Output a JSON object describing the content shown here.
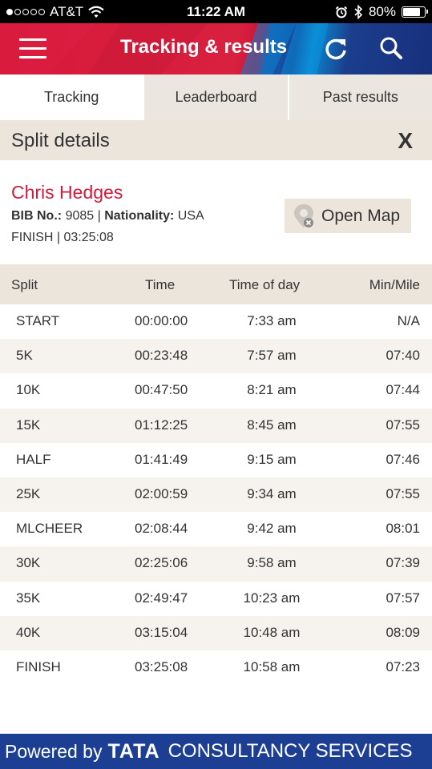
{
  "status_bar": {
    "carrier": "AT&T",
    "time": "11:22 AM",
    "battery": "80%",
    "battery_level": 0.8,
    "icons": [
      "wifi-icon",
      "alarm-icon",
      "bluetooth-icon",
      "battery-icon"
    ]
  },
  "header": {
    "title": "Tracking & results",
    "icons": [
      "menu-icon",
      "refresh-icon",
      "search-icon"
    ]
  },
  "tabs": [
    {
      "label": "Tracking",
      "active": true
    },
    {
      "label": "Leaderboard",
      "active": false
    },
    {
      "label": "Past results",
      "active": false
    }
  ],
  "split_details": {
    "title": "Split details",
    "close_label": "X"
  },
  "runner": {
    "name": "Chris Hedges",
    "bib_label": "BIB No.:",
    "bib": "9085",
    "nationality_label": "Nationality:",
    "nationality": "USA",
    "finish": "FINISH | 03:25:08",
    "open_map_label": "Open Map"
  },
  "table": {
    "columns": [
      "Split",
      "Time",
      "Time of day",
      "Min/Mile"
    ],
    "rows": [
      {
        "split": "START",
        "time": "00:00:00",
        "time_of_day": "7:33 am",
        "min_mile": "N/A"
      },
      {
        "split": "5K",
        "time": "00:23:48",
        "time_of_day": "7:57 am",
        "min_mile": "07:40"
      },
      {
        "split": "10K",
        "time": "00:47:50",
        "time_of_day": "8:21 am",
        "min_mile": "07:44"
      },
      {
        "split": "15K",
        "time": "01:12:25",
        "time_of_day": "8:45 am",
        "min_mile": "07:55"
      },
      {
        "split": "HALF",
        "time": "01:41:49",
        "time_of_day": "9:15 am",
        "min_mile": "07:46"
      },
      {
        "split": "25K",
        "time": "02:00:59",
        "time_of_day": "9:34 am",
        "min_mile": "07:55"
      },
      {
        "split": "MLCHEER",
        "time": "02:08:44",
        "time_of_day": "9:42 am",
        "min_mile": "08:01"
      },
      {
        "split": "30K",
        "time": "02:25:06",
        "time_of_day": "9:58 am",
        "min_mile": "07:39"
      },
      {
        "split": "35K",
        "time": "02:49:47",
        "time_of_day": "10:23 am",
        "min_mile": "07:57"
      },
      {
        "split": "40K",
        "time": "03:15:04",
        "time_of_day": "10:48 am",
        "min_mile": "08:09"
      },
      {
        "split": "FINISH",
        "time": "03:25:08",
        "time_of_day": "10:58 am",
        "min_mile": "07:23"
      }
    ]
  },
  "footer": {
    "powered_by": "Powered by",
    "tata": "TATA",
    "company": "CONSULTANCY SERVICES"
  },
  "colors": {
    "accent_red": "#d21a3b",
    "footer_blue": "#1c3f94",
    "panel_beige": "#ebe5dc"
  }
}
